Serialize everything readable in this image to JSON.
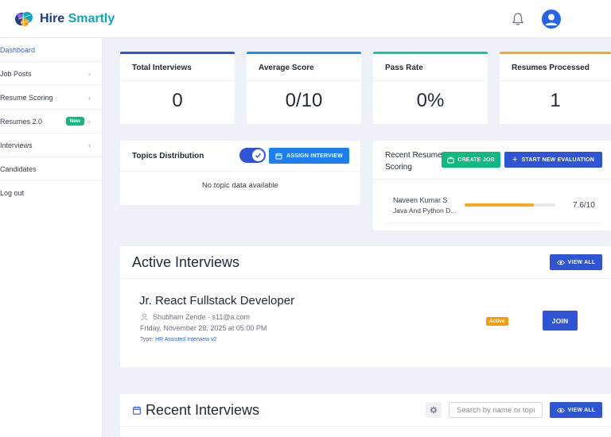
{
  "brand": {
    "name_part1": "Hire",
    "name_part2": "Smartly"
  },
  "sidebar": {
    "items": [
      {
        "label": "Dashboard"
      },
      {
        "label": "Job Posts"
      },
      {
        "label": "Resume Scoring"
      },
      {
        "label": "Resumes 2.0",
        "badge": "New"
      },
      {
        "label": "Interviews"
      },
      {
        "label": "Candidates"
      },
      {
        "label": "Log out"
      }
    ]
  },
  "stats": [
    {
      "title": "Total Interviews",
      "value": "0",
      "color": "#2f55d4"
    },
    {
      "title": "Average Score",
      "value": "0/10",
      "color": "#1d8fe8"
    },
    {
      "title": "Pass Rate",
      "value": "0%",
      "color": "#10c9a0"
    },
    {
      "title": "Resumes Processed",
      "value": "1",
      "color": "#f6a821"
    }
  ],
  "topics": {
    "title": "Topics Distribution",
    "assign_label": "ASSIGN INTERVIEW",
    "empty_text": "No topic data available"
  },
  "recent_scoring": {
    "title_line1": "Recent Resume",
    "title_line2": "Scoring",
    "create_job_label": "CREATE JOB",
    "start_eval_label": "START NEW EVALUATION",
    "entries": [
      {
        "name": "Naveen Kumar S",
        "role": "Java And Python D...",
        "score": "7.6/10",
        "progress": 0.76
      }
    ]
  },
  "active_interviews": {
    "title": "Active Interviews",
    "view_all_label": "VIEW ALL",
    "items": [
      {
        "title": "Jr. React Fullstack Developer",
        "candidate": "Shubham Zende - s11@a.com",
        "datetime": "Friday, November 28, 2025 at 05:00 PM",
        "type_label": "Type:",
        "type_value": "HR Assisted Interview v2",
        "status": "Active",
        "join_label": "JOIN"
      }
    ]
  },
  "recent_interviews": {
    "title": "Recent Interviews",
    "search_placeholder": "Search by name or topic",
    "view_all_label": "VIEW ALL"
  },
  "icons": {
    "bell": "bell-icon",
    "avatar": "user-avatar-icon",
    "calendar": "calendar-icon",
    "eye": "eye-icon",
    "plus": "plus-icon",
    "briefcase": "briefcase-icon",
    "person": "person-icon",
    "filter": "filter-icon"
  }
}
